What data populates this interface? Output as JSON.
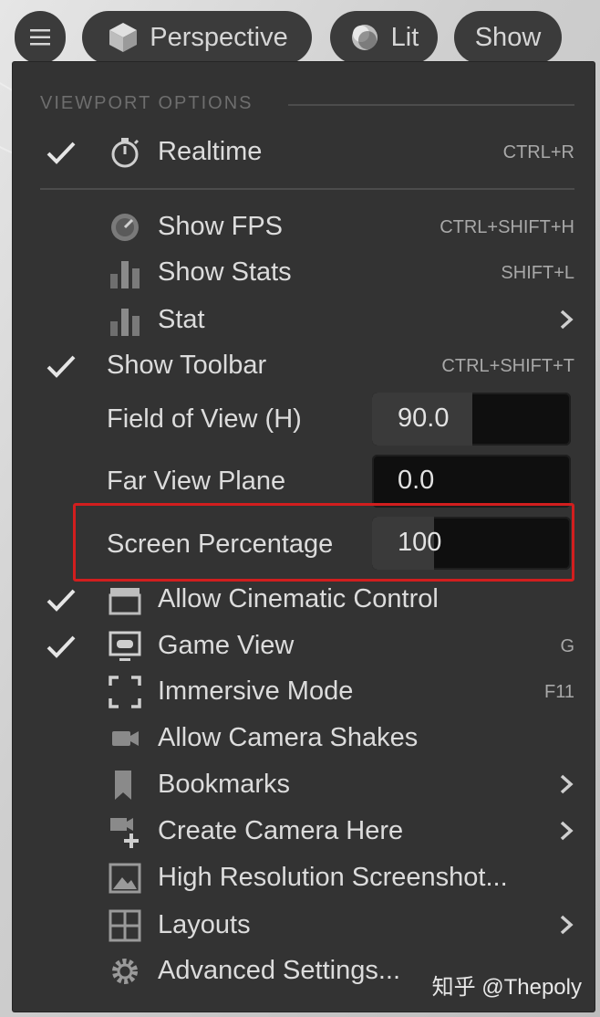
{
  "toolbar": {
    "menu_icon": "hamburger-icon",
    "perspective_label": "Perspective",
    "lit_label": "Lit",
    "show_label": "Show"
  },
  "menu": {
    "section_title": "VIEWPORT OPTIONS",
    "items": [
      {
        "label": "Realtime",
        "shortcut": "CTRL+R",
        "checked": true,
        "icon": "stopwatch-icon"
      },
      {
        "label": "Show FPS",
        "shortcut": "CTRL+SHIFT+H",
        "checked": false,
        "icon": "gauge-icon"
      },
      {
        "label": "Show Stats",
        "shortcut": "SHIFT+L",
        "checked": false,
        "icon": "bar-chart-icon"
      },
      {
        "label": "Stat",
        "shortcut": "",
        "checked": false,
        "icon": "bar-chart-icon",
        "submenu": true
      },
      {
        "label": "Show Toolbar",
        "shortcut": "CTRL+SHIFT+T",
        "checked": true
      },
      {
        "label": "Allow Cinematic Control",
        "shortcut": "",
        "checked": true,
        "icon": "clapperboard-icon"
      },
      {
        "label": "Game View",
        "shortcut": "G",
        "checked": true,
        "icon": "gamepad-monitor-icon"
      },
      {
        "label": "Immersive Mode",
        "shortcut": "F11",
        "checked": false,
        "icon": "fullscreen-icon"
      },
      {
        "label": "Allow Camera Shakes",
        "shortcut": "",
        "checked": false,
        "icon": "camera-icon"
      },
      {
        "label": "Bookmarks",
        "shortcut": "",
        "checked": false,
        "icon": "bookmark-icon",
        "submenu": true
      },
      {
        "label": "Create Camera Here",
        "shortcut": "",
        "checked": false,
        "icon": "camera-add-icon",
        "submenu": true
      },
      {
        "label": "High Resolution Screenshot...",
        "shortcut": "",
        "checked": false,
        "icon": "image-icon"
      },
      {
        "label": "Layouts",
        "shortcut": "",
        "checked": false,
        "icon": "layout-icon",
        "submenu": true
      },
      {
        "label": "Advanced Settings...",
        "shortcut": "",
        "checked": false,
        "icon": "gear-icon"
      }
    ],
    "fields": [
      {
        "label": "Field of View (H)",
        "value": "90.0"
      },
      {
        "label": "Far View Plane",
        "value": "0.0"
      },
      {
        "label": "Screen Percentage",
        "value": "100"
      }
    ]
  },
  "watermark": "知乎 @Thepoly",
  "colors": {
    "highlight": "#d21e1e",
    "menu_bg": "#333333",
    "field_bg": "#0f0f0f"
  }
}
